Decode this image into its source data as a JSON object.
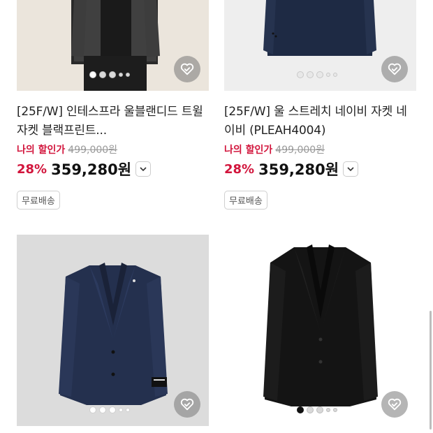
{
  "products": [
    {
      "name": "[25F/W] 인테스프라 울블랜디드 트윌 자켓 블랙프린트...",
      "sale_label": "나의 할인가",
      "original_price": "499,000원",
      "discount": "28%",
      "price": "359,280원",
      "badge": "무료배송",
      "image_icon": "tweed-jacket-model-photo",
      "dots": 5,
      "active_dot": 0
    },
    {
      "name": "[25F/W] 울 스트레치 네이비 자켓 네이비 (PLEAH4004)",
      "sale_label": "나의 할인가",
      "original_price": "499,000원",
      "discount": "28%",
      "price": "359,280원",
      "badge": "무료배송",
      "image_icon": "navy-jacket-photo",
      "dots": 5,
      "active_dot": 0
    },
    {
      "image_icon": "navy-blazer-photo",
      "dots": 5,
      "active_dot": 0
    },
    {
      "image_icon": "black-blazer-photo",
      "dots": 5,
      "active_dot": 0
    }
  ],
  "colors": {
    "sale_red": "#d2153c",
    "wish_bg": "#8a8a8a"
  }
}
